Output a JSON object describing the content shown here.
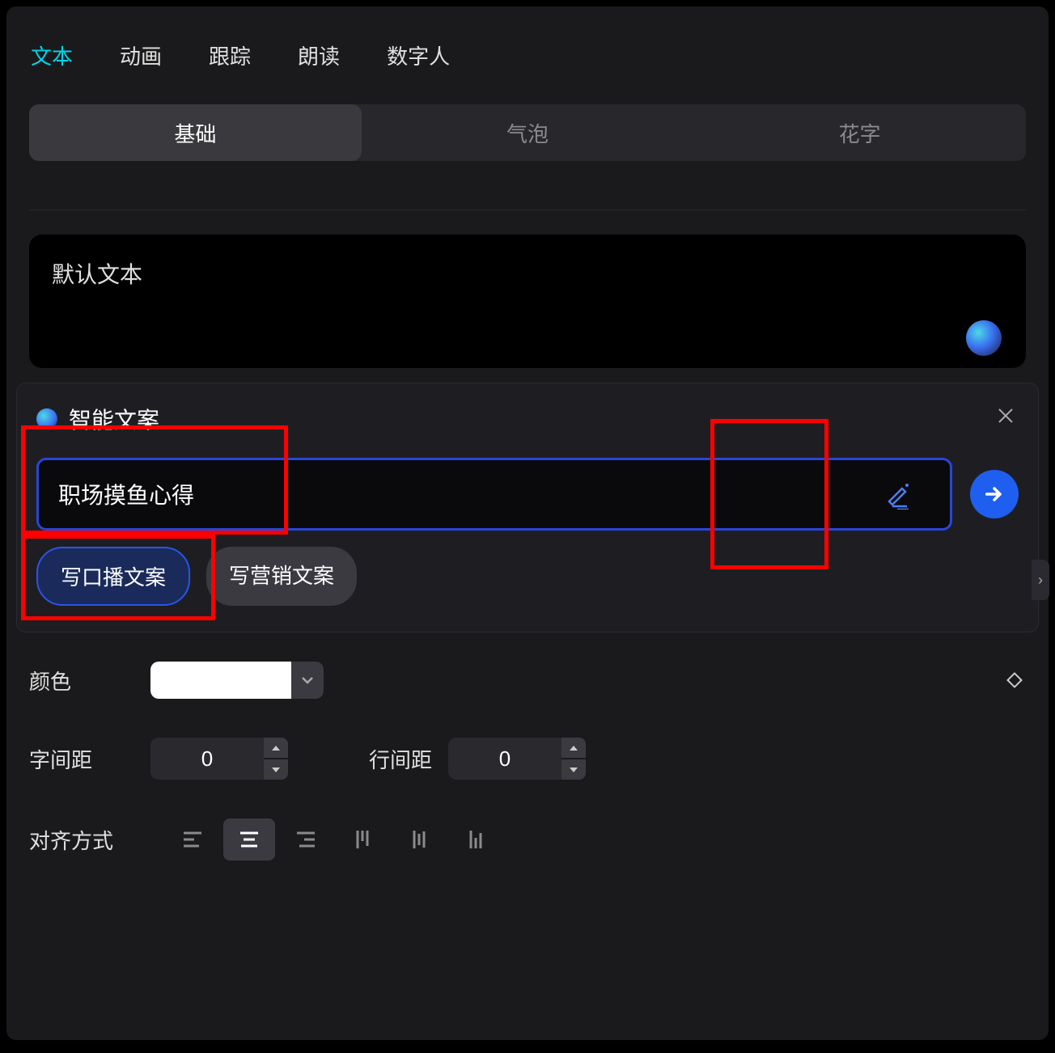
{
  "topTabs": [
    "文本",
    "动画",
    "跟踪",
    "朗读",
    "数字人"
  ],
  "subTabs": [
    "基础",
    "气泡",
    "花字"
  ],
  "textArea": {
    "value": "默认文本"
  },
  "smartPanel": {
    "title": "智能文案",
    "inputValue": "职场摸鱼心得",
    "pills": [
      "写口播文案",
      "写营销文案"
    ]
  },
  "props": {
    "colorLabel": "颜色",
    "colorValue": "#FFFFFF",
    "letterSpacingLabel": "字间距",
    "letterSpacingValue": "0",
    "lineSpacingLabel": "行间距",
    "lineSpacingValue": "0",
    "alignLabel": "对齐方式"
  }
}
